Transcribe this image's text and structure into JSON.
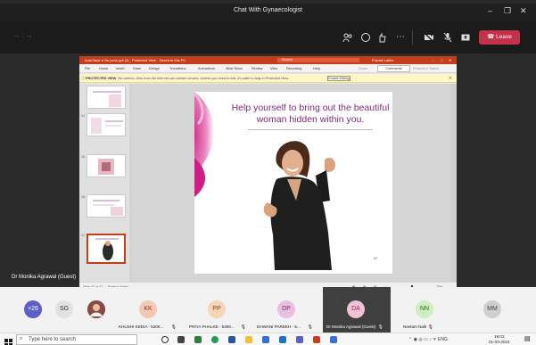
{
  "window": {
    "title": "Chat With Gynaecologist"
  },
  "meeting": {
    "timer": "-- : --",
    "leave_label": "Leave",
    "presenter_label": "Dr Monika Agrawal (Guest)"
  },
  "ppt": {
    "title_text": "AutoSave  ●  On     pcos ppt (3)  -  Protected View  -  Saved to this PC",
    "search_text": "Search",
    "user_text": "Pranali Lakhe",
    "ribbon_tabs": [
      "File",
      "Home",
      "Insert",
      "Draw",
      "Design",
      "Transitions",
      "Animations",
      "Slide Show",
      "Review",
      "View",
      "Recording",
      "Help"
    ],
    "share_label": "Share",
    "comments_label": "Comments",
    "present_label": "Present in Teams",
    "protected_label": "PROTECTED VIEW",
    "protected_text": "Be careful—files from the Internet can contain viruses. Unless you need to edit, it's safer to stay in Protected View.",
    "enable_editing_label": "Enable Editing",
    "thumb_numbers": [
      "14",
      "15",
      "16",
      "17"
    ],
    "slide_heading": "Help yourself to bring out the beautiful woman hidden within you.",
    "slide_page_number": "47",
    "status_left": "Slide 47 of 47",
    "status_lang": "English (India)",
    "zoom_label": "75%"
  },
  "participants": {
    "overflow": "+26",
    "initials_sg": "SG",
    "tiles": [
      {
        "initials": "KK",
        "name": "KHUSHI KEDIA - 5300...",
        "color": "#f4c9b4"
      },
      {
        "initials": "PP",
        "name": "PRIYA PHALKE - 5300...",
        "color": "#f6d6b5"
      },
      {
        "initials": "DP",
        "name": "DHWANI PAREKH - 5...",
        "color": "#e9bfe0"
      },
      {
        "initials": "DA",
        "name": "Dr Monika Agrawal (Guest)",
        "color": "#f0c2d7"
      },
      {
        "initials": "NN",
        "name": "Neelam Naik",
        "color": "#cdeec2"
      },
      {
        "initials": "MM",
        "name": "",
        "color": "#cfcfcf"
      }
    ]
  },
  "taskbar": {
    "search_placeholder": "Type here to search",
    "tray_text": "ENG",
    "time": "19:03",
    "date": "01-03-2024"
  },
  "colors": {
    "accent": "#c43e1c",
    "leave": "#c4314b",
    "heading": "#7b2a78"
  }
}
